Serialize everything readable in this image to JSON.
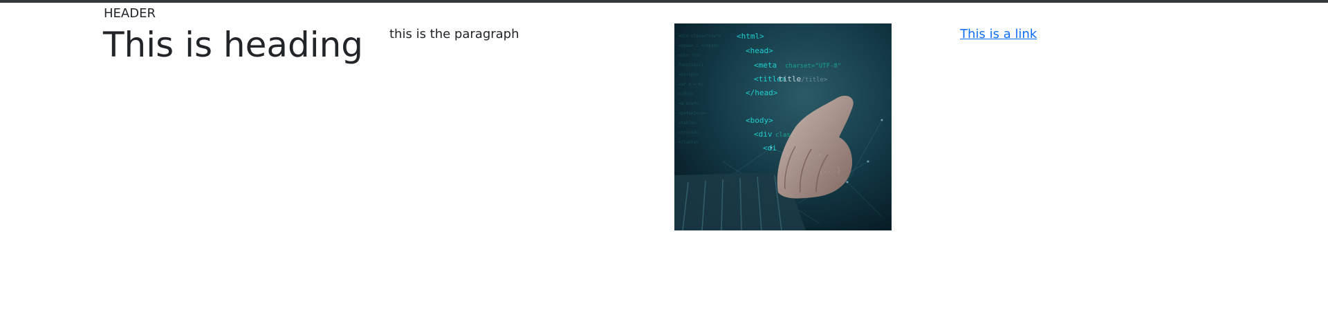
{
  "header": {
    "label": "HEADER"
  },
  "main": {
    "heading": "This is heading",
    "paragraph": "this is the paragraph",
    "link_text": "This is a link"
  },
  "image": {
    "icon": "code-laptop-photo",
    "code_lines": [
      "<html>",
      "<head>",
      "<meta charset=\"UTF-8\">",
      "<title>title</title>",
      "</head>",
      "<body>",
      "<div class",
      "<di",
      "{...}"
    ]
  },
  "colors": {
    "top_bar": "#343a40",
    "text": "#212529",
    "link": "#0d6efd",
    "photo_bg": "#0d2a33",
    "code_accent": "#19c7c7"
  }
}
